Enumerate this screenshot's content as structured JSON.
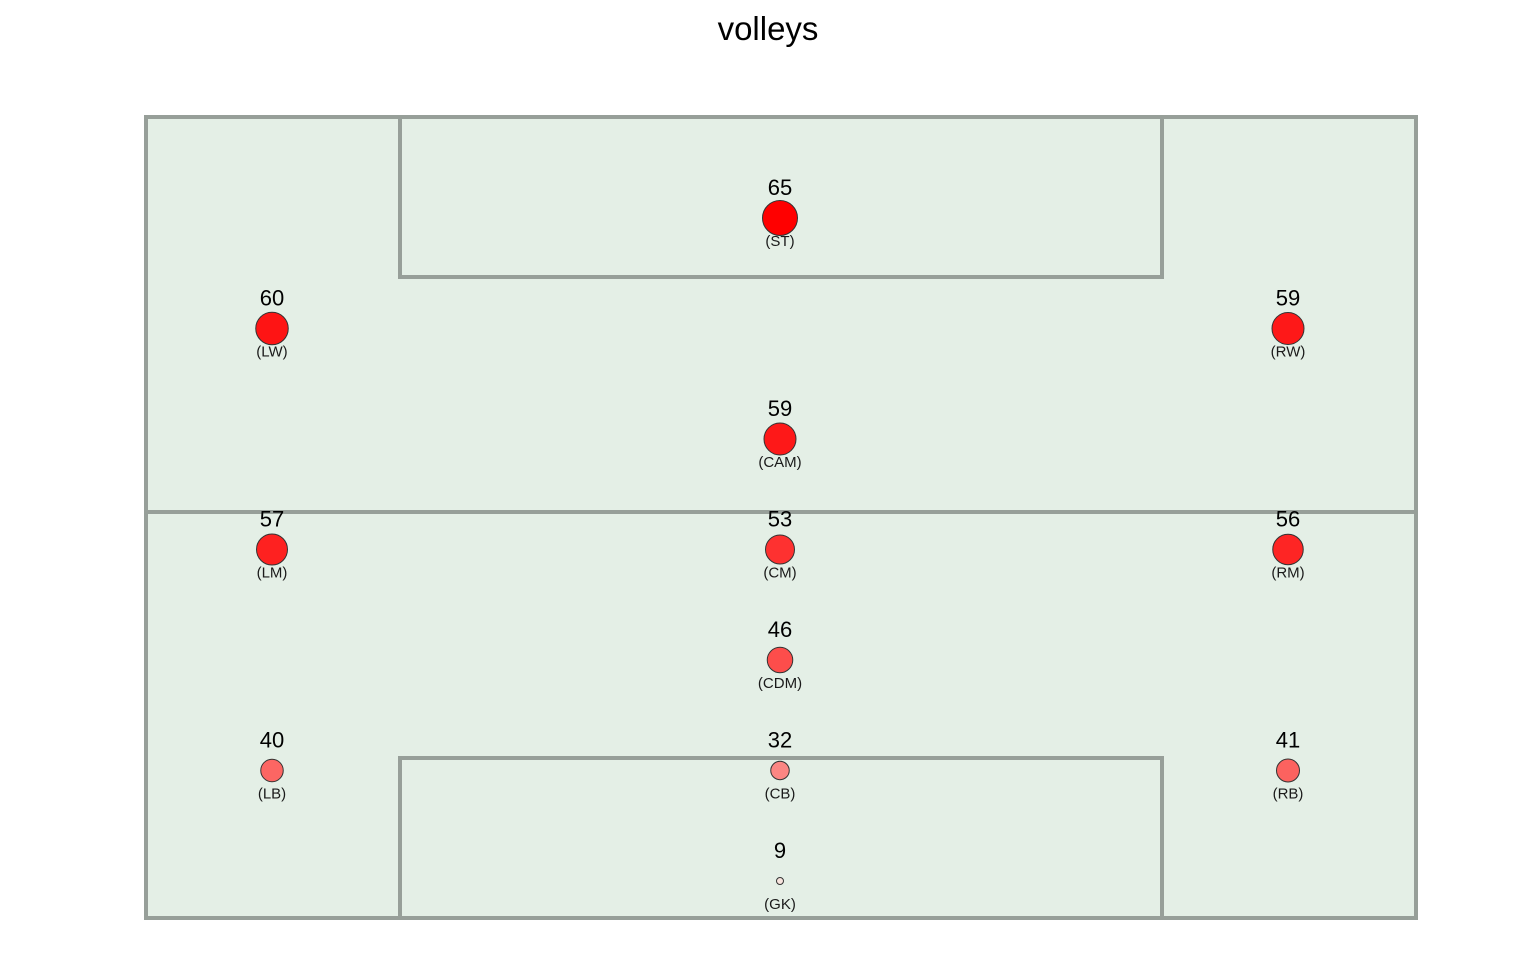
{
  "chart_data": {
    "type": "scatter",
    "title": "volleys",
    "colors": {
      "pitch_fill": "#e4efe6",
      "pitch_line": "#979f99",
      "dot_max": "#ff0000",
      "dot_min": "#f8e4de"
    },
    "value_range": [
      9,
      65
    ],
    "points": [
      {
        "position": "(ST)",
        "value": 65,
        "col": 1,
        "row": 0
      },
      {
        "position": "(LW)",
        "value": 60,
        "col": 0,
        "row": 1
      },
      {
        "position": "(RW)",
        "value": 59,
        "col": 2,
        "row": 1
      },
      {
        "position": "(CAM)",
        "value": 59,
        "col": 1,
        "row": 2
      },
      {
        "position": "(LM)",
        "value": 57,
        "col": 0,
        "row": 3
      },
      {
        "position": "(CM)",
        "value": 53,
        "col": 1,
        "row": 3
      },
      {
        "position": "(RM)",
        "value": 56,
        "col": 2,
        "row": 3
      },
      {
        "position": "(CDM)",
        "value": 46,
        "col": 1,
        "row": 4
      },
      {
        "position": "(LB)",
        "value": 40,
        "col": 0,
        "row": 5
      },
      {
        "position": "(CB)",
        "value": 32,
        "col": 1,
        "row": 5
      },
      {
        "position": "(RB)",
        "value": 41,
        "col": 2,
        "row": 5
      },
      {
        "position": "(GK)",
        "value": 9,
        "col": 1,
        "row": 6
      }
    ]
  }
}
